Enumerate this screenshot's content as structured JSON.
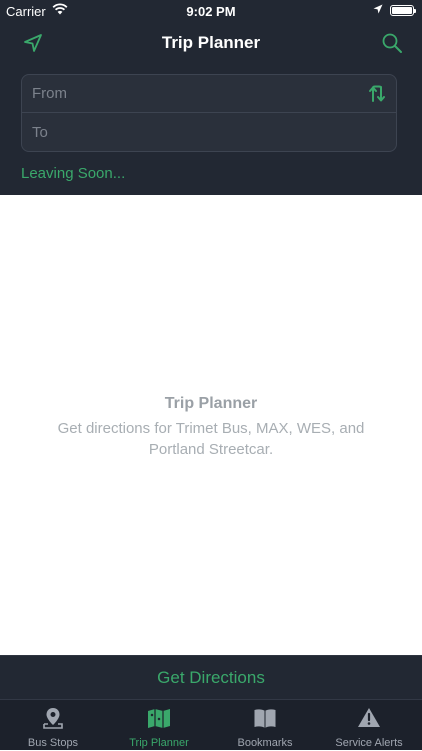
{
  "status_bar": {
    "carrier": "Carrier",
    "time": "9:02 PM"
  },
  "nav": {
    "title": "Trip Planner",
    "left_icon": "location-arrow-icon",
    "right_icon": "search-icon"
  },
  "form": {
    "from_placeholder": "From",
    "to_placeholder": "To",
    "swap_icon": "swap-icon",
    "leaving_label": "Leaving Soon..."
  },
  "empty_state": {
    "title": "Trip Planner",
    "subtitle": "Get directions for Trimet Bus, MAX, WES, and Portland Streetcar."
  },
  "action": {
    "get_directions_label": "Get Directions"
  },
  "tabs": [
    {
      "label": "Bus Stops",
      "icon": "map-pin-icon",
      "active": false
    },
    {
      "label": "Trip Planner",
      "icon": "map-icon",
      "active": true
    },
    {
      "label": "Bookmarks",
      "icon": "book-icon",
      "active": false
    },
    {
      "label": "Service Alerts",
      "icon": "alert-icon",
      "active": false
    }
  ],
  "colors": {
    "header_bg": "#222833",
    "accent": "#3aa86b",
    "tabbar_bg": "#1c212b"
  }
}
